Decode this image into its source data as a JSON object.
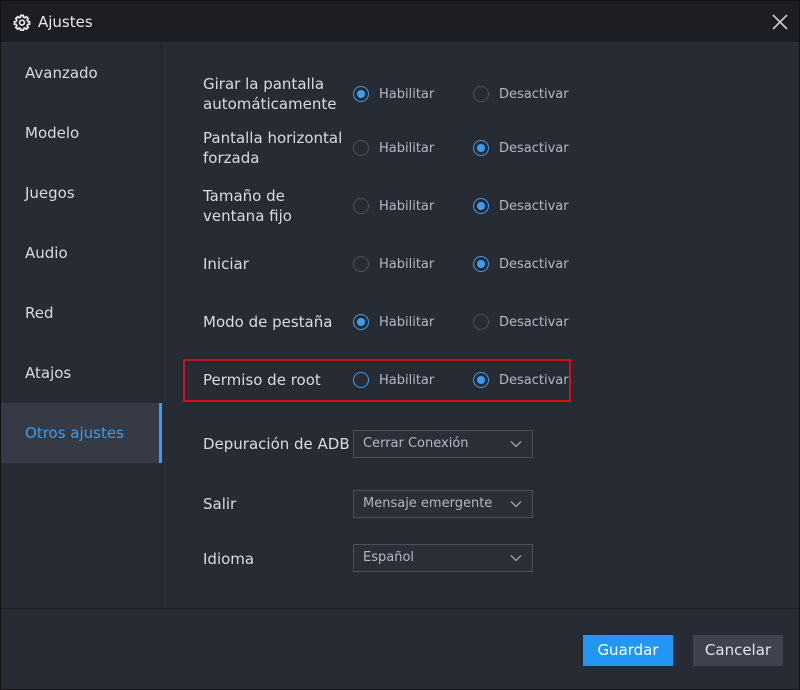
{
  "window": {
    "title": "Ajustes"
  },
  "colors": {
    "accent": "#3c9cf0",
    "highlight": "#d0121b",
    "primary_button": "#2196f3"
  },
  "icons": {
    "title": "gear-icon",
    "close": "close-icon",
    "dropdown": "chevron-down-icon"
  },
  "sidebar": {
    "items": [
      {
        "label": "Avanzado",
        "active": false
      },
      {
        "label": "Modelo",
        "active": false
      },
      {
        "label": "Juegos",
        "active": false
      },
      {
        "label": "Audio",
        "active": false
      },
      {
        "label": "Red",
        "active": false
      },
      {
        "label": "Atajos",
        "active": false
      },
      {
        "label": "Otros ajustes",
        "active": true
      }
    ]
  },
  "settings": {
    "enable_label": "Habilitar",
    "disable_label": "Desactivar",
    "rows": [
      {
        "label": "Girar la pantalla automáticamente",
        "selected": "Habilitar"
      },
      {
        "label": "Pantalla horizontal forzada",
        "selected": "Desactivar"
      },
      {
        "label": "Tamaño de ventana fijo",
        "selected": "Desactivar"
      },
      {
        "label": "Iniciar",
        "selected": "Desactivar"
      },
      {
        "label": "Modo de pestaña",
        "selected": "Habilitar"
      },
      {
        "label": "Permiso de root",
        "selected": "Desactivar"
      }
    ]
  },
  "selects": [
    {
      "label": "Depuración de ADB",
      "value": "Cerrar Conexión"
    },
    {
      "label": "Salir",
      "value": "Mensaje emergente"
    },
    {
      "label": "Idioma",
      "value": "Español"
    }
  ],
  "footer": {
    "save_label": "Guardar",
    "cancel_label": "Cancelar"
  }
}
